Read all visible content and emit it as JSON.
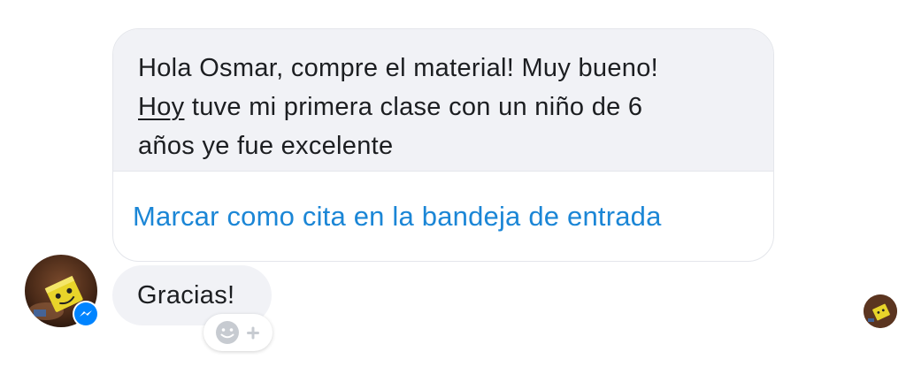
{
  "message": {
    "line1": "Hola Osmar, compre el material! Muy bueno!",
    "line2_word": "Hoy",
    "line2_rest": " tuve mi primera clase con un niño de 6",
    "line3": "años ye fue excelente",
    "action_label": "Marcar como cita en la bandeja de entrada"
  },
  "reply": {
    "text": "Gracias!"
  },
  "icons": {
    "avatar": "contact-avatar",
    "badge": "messenger-icon",
    "reaction": "add-reaction-icon",
    "read_receipt": "seen-avatar"
  },
  "colors": {
    "link": "#1b86d6",
    "bubble": "#f1f2f6",
    "messenger_blue": "#0084ff"
  }
}
